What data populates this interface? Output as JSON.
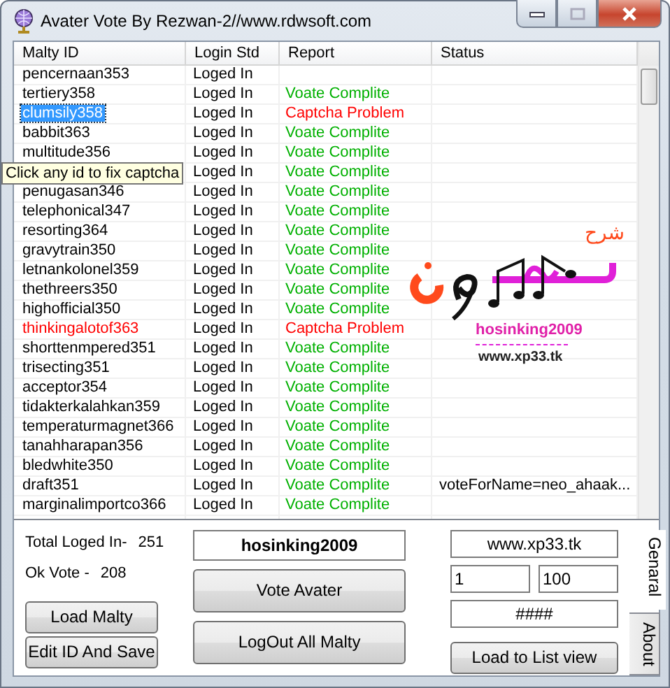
{
  "window": {
    "title": "Avater Vote  By Rezwan-2//www.rdwsoft.com"
  },
  "list": {
    "columns": [
      "Malty ID",
      "Login Std",
      "Report",
      "Status"
    ],
    "rows": [
      {
        "id": "pencernaan353",
        "login": "Loged In",
        "selected": false,
        "id_alert": false
      },
      {
        "id": "tertiery358",
        "login": "Loged In",
        "report": "Voate Complite",
        "problem": false,
        "selected": false,
        "id_alert": false
      },
      {
        "id": "clumsily358",
        "login": "Loged In",
        "report": "Captcha Problem",
        "problem": true,
        "selected": true,
        "id_alert": false
      },
      {
        "id": "babbit363",
        "login": "Loged In",
        "report": "Voate Complite",
        "problem": false,
        "selected": false,
        "id_alert": false
      },
      {
        "id": "multitude356",
        "login": "Loged In",
        "report": "Voate Complite",
        "problem": false,
        "selected": false,
        "id_alert": false
      },
      {
        "login": "Loged In",
        "report": "Voate Complite",
        "problem": false
      },
      {
        "id": "penugasan346",
        "login": "Loged In",
        "report": "Voate Complite",
        "problem": false,
        "selected": false,
        "id_alert": false
      },
      {
        "id": "telephonical347",
        "login": "Loged In",
        "report": "Voate Complite",
        "problem": false,
        "selected": false,
        "id_alert": false
      },
      {
        "id": "resorting364",
        "login": "Loged In",
        "report": "Voate Complite",
        "problem": false,
        "selected": false,
        "id_alert": false
      },
      {
        "id": "gravytrain350",
        "login": "Loged In",
        "report": "Voate Complite",
        "problem": false,
        "selected": false,
        "id_alert": false
      },
      {
        "id": "letnankolonel359",
        "login": "Loged In",
        "report": "Voate Complite",
        "problem": false,
        "selected": false,
        "id_alert": false
      },
      {
        "id": "thethreers350",
        "login": "Loged In",
        "report": "Voate Complite",
        "problem": false,
        "selected": false,
        "id_alert": false
      },
      {
        "id": "highofficial350",
        "login": "Loged In",
        "report": "Voate Complite",
        "problem": false,
        "selected": false,
        "id_alert": false
      },
      {
        "id": "thinkingalotof363",
        "login": "Loged In",
        "report": "Captcha Problem",
        "problem": true,
        "selected": false,
        "id_alert": true
      },
      {
        "id": "shorttenmpered351",
        "login": "Loged In",
        "report": "Voate Complite",
        "problem": false,
        "selected": false,
        "id_alert": false
      },
      {
        "id": "trisecting351",
        "login": "Loged In",
        "report": "Voate Complite",
        "problem": false,
        "selected": false,
        "id_alert": false
      },
      {
        "id": "acceptor354",
        "login": "Loged In",
        "report": "Voate Complite",
        "problem": false,
        "selected": false,
        "id_alert": false
      },
      {
        "id": "tidakterkalahkan359",
        "login": "Loged In",
        "report": "Voate Complite",
        "problem": false,
        "selected": false,
        "id_alert": false
      },
      {
        "id": "temperaturmagnet366",
        "login": "Loged In",
        "report": "Voate Complite",
        "problem": false,
        "selected": false,
        "id_alert": false
      },
      {
        "id": "tanahharapan356",
        "login": "Loged In",
        "report": "Voate Complite",
        "problem": false,
        "selected": false,
        "id_alert": false
      },
      {
        "id": "bledwhite350",
        "login": "Loged In",
        "report": "Voate Complite",
        "problem": false,
        "selected": false,
        "id_alert": false
      },
      {
        "id": "draft351",
        "login": "Loged In",
        "report": "Voate Complite",
        "problem": false,
        "status": "voteForName=neo_ahaak...",
        "selected": false,
        "id_alert": false
      },
      {
        "id": "marginalimportco366",
        "login": "Loged In",
        "report": "Voate Complite",
        "problem": false,
        "selected": false,
        "id_alert": false
      }
    ],
    "tooltip": "Click any id to fix captcha",
    "logo": {
      "caption": "شرح",
      "name": "hosinking2009",
      "site": "www.xp33.tk"
    }
  },
  "stats": [
    {
      "label": "Total Loged In-",
      "value": "251"
    },
    {
      "label": "Ok Vote -",
      "value": "208"
    }
  ],
  "left_buttons": [
    "Load Malty",
    "Edit ID And Save"
  ],
  "name_field": {
    "value": "hosinking2009"
  },
  "middle_buttons": [
    "Vote Avater",
    "LogOut All Malty"
  ],
  "site_field": {
    "value": "www.xp33.tk"
  },
  "range_fields": [
    {
      "value": "1"
    },
    {
      "value": "100"
    }
  ],
  "code_field": {
    "value": "####"
  },
  "load_button": "Load to List view",
  "tabs": [
    {
      "label": "Genaral",
      "selected": true
    },
    {
      "label": "About",
      "selected": false
    }
  ]
}
